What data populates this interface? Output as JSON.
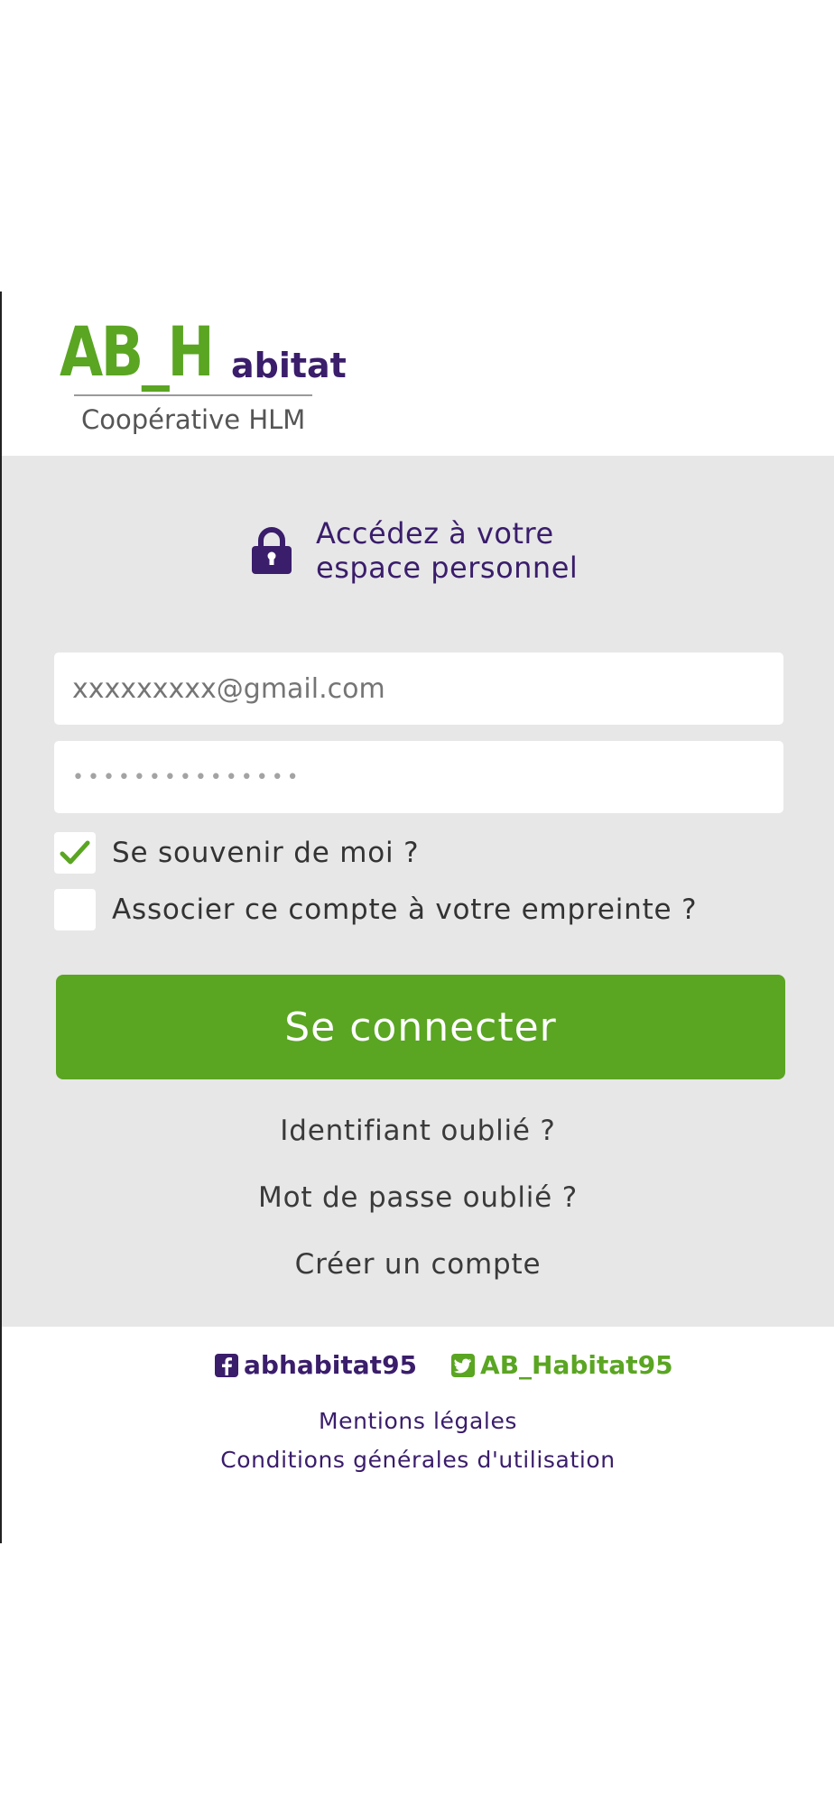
{
  "brand": {
    "logo_main": "AB_H",
    "logo_suffix": "abitat",
    "logo_subtitle": "Coopérative HLM",
    "primary_color": "#5aa522",
    "secondary_color": "#3a1d6b"
  },
  "header": {
    "title_line1": "Accédez à votre",
    "title_line2": "espace personnel",
    "icon": "lock-icon"
  },
  "form": {
    "email_placeholder": "xxxxxxxxx@gmail.com",
    "password_value": "•••••••••••••••",
    "remember_label": "Se souvenir de moi ?",
    "remember_checked": true,
    "fingerprint_label": "Associer ce compte à votre empreinte ?",
    "fingerprint_checked": false,
    "submit_label": "Se connecter"
  },
  "links": {
    "forgot_id": "Identifiant oublié ?",
    "forgot_password": "Mot de passe oublié ?",
    "create_account": "Créer un compte"
  },
  "social": {
    "facebook_handle": "abhabitat95",
    "twitter_handle": "AB_Habitat95"
  },
  "footer": {
    "legal": "Mentions légales",
    "terms": "Conditions générales d'utilisation"
  }
}
